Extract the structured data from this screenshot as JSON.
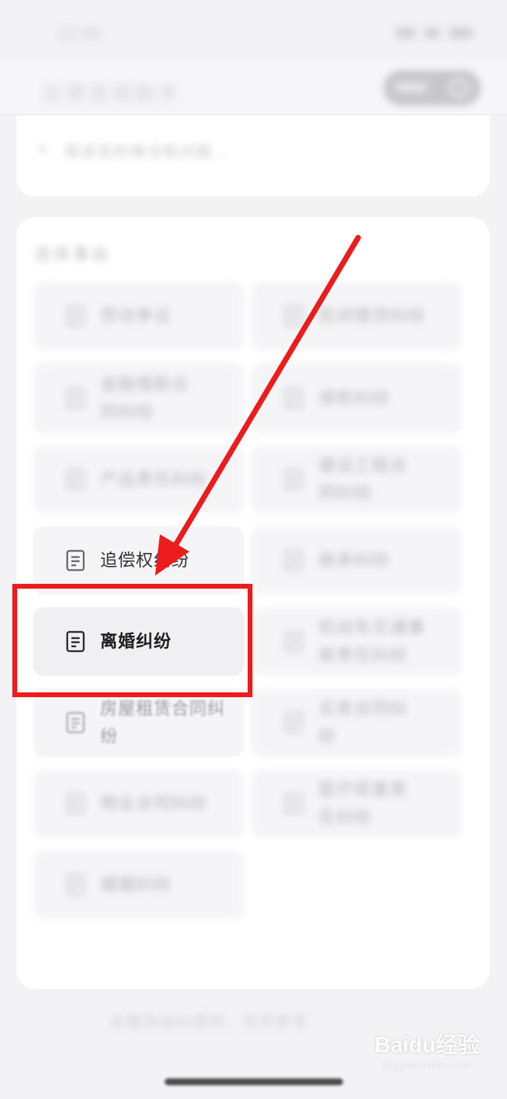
{
  "status_bar": {
    "time": "12:00"
  },
  "topbar": {
    "title": "法律咨询助手"
  },
  "input": {
    "placeholder": "简述您的情况和问题…"
  },
  "section": {
    "title": "选择事由"
  },
  "items": [
    {
      "label": "劳动争议"
    },
    {
      "label": "民间借贷纠纷"
    },
    {
      "label": "金融借款合同纠纷"
    },
    {
      "label": "侵权纠纷"
    },
    {
      "label": "产品责任纠纷"
    },
    {
      "label": "建设工程合同纠纷"
    },
    {
      "label": "追偿权纠纷"
    },
    {
      "label": "继承纠纷"
    },
    {
      "label": "离婚纠纷"
    },
    {
      "label": "机动车交通事故责任纠纷"
    },
    {
      "label": "房屋租赁合同纠纷"
    },
    {
      "label": "买卖合同纠纷"
    },
    {
      "label": "物业合同纠纷"
    },
    {
      "label": "医疗损害责任纠纷"
    },
    {
      "label": "婚姻纠纷"
    }
  ],
  "footer": {
    "note": "本服务由AI提供，仅供参考"
  },
  "watermark": {
    "main": "Baidu经验",
    "sub": "jingyan.baidu.com"
  },
  "annotation": {
    "color": "#ec1c1c",
    "highlighted_item": "离婚纠纷"
  }
}
